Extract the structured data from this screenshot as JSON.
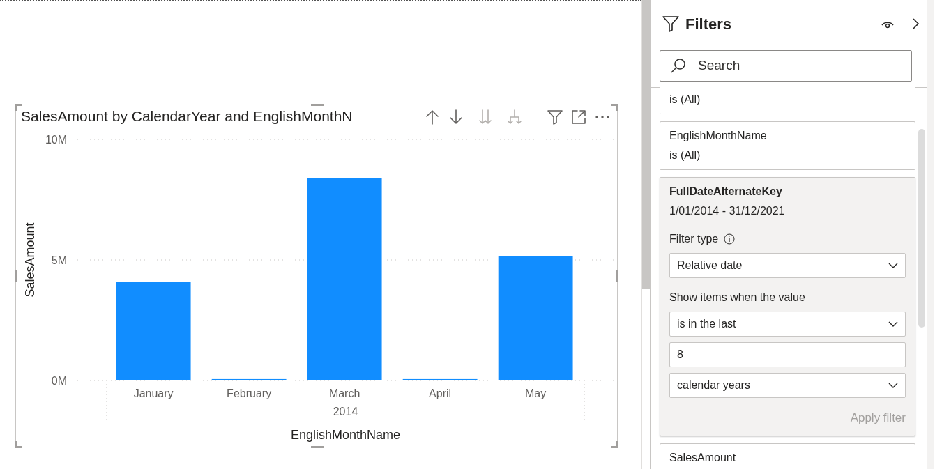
{
  "visual": {
    "title": "SalesAmount by CalendarYear and EnglishMonthN",
    "year_label": "2014",
    "chart_data": {
      "type": "bar",
      "xlabel": "EnglishMonthName",
      "ylabel": "SalesAmount",
      "categories": [
        "January",
        "February",
        "March",
        "April",
        "May"
      ],
      "values": [
        4100000,
        60000,
        8400000,
        60000,
        5170000
      ],
      "ylim": [
        0,
        10000000
      ],
      "yticks": [
        {
          "value": 0,
          "label": "0M"
        },
        {
          "value": 5000000,
          "label": "5M"
        },
        {
          "value": 10000000,
          "label": "10M"
        }
      ]
    }
  },
  "filters_pane": {
    "title": "Filters",
    "search": {
      "placeholder": "Search"
    },
    "cards": [
      {
        "kind": "summary",
        "condition": "is (All)"
      },
      {
        "kind": "summary",
        "field": "EnglishMonthName",
        "condition": "is (All)"
      },
      {
        "kind": "expanded",
        "field": "FullDateAlternateKey",
        "condition": "1/01/2014 - 31/12/2021",
        "filter_type_label": "Filter type",
        "filter_type": "Relative date",
        "show_items_label": "Show items when the value",
        "operator": "is in the last",
        "amount": "8",
        "unit": "calendar years",
        "apply_button": {
          "label": "Apply filter",
          "disabled": true
        }
      },
      {
        "kind": "summary",
        "field": "SalesAmount"
      }
    ]
  }
}
